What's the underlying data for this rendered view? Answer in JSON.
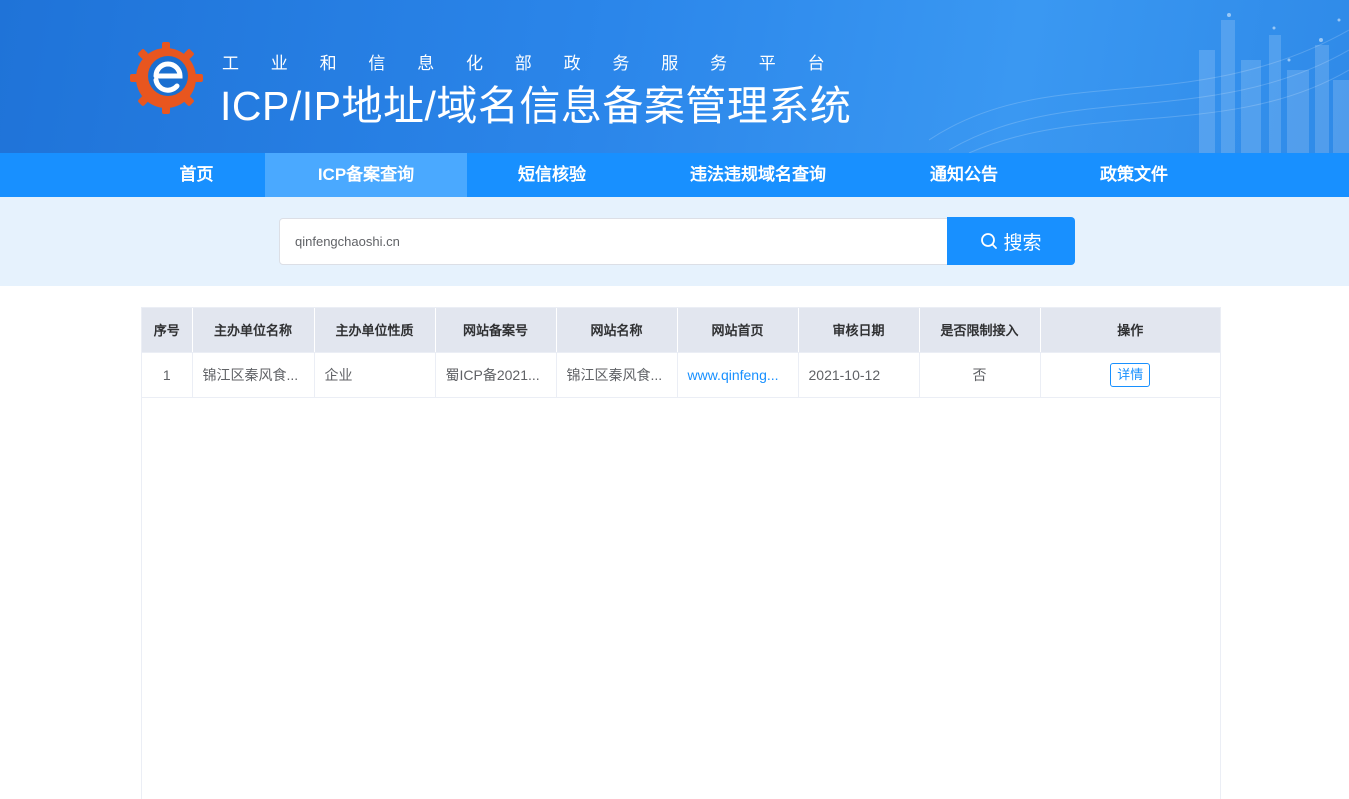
{
  "header": {
    "subtitle": "工业和信息化部政务服务平台",
    "title": "ICP/IP地址/域名信息备案管理系统"
  },
  "nav": {
    "items": [
      {
        "label": "首页"
      },
      {
        "label": "ICP备案查询",
        "active": true
      },
      {
        "label": "短信核验"
      },
      {
        "label": "违法违规域名查询"
      },
      {
        "label": "通知公告"
      },
      {
        "label": "政策文件"
      }
    ]
  },
  "search": {
    "value": "qinfengchaoshi.cn",
    "button_label": "搜索",
    "button_icon": "search-icon"
  },
  "table": {
    "columns": [
      "序号",
      "主办单位名称",
      "主办单位性质",
      "网站备案号",
      "网站名称",
      "网站首页",
      "审核日期",
      "是否限制接入",
      "操作"
    ],
    "rows": [
      {
        "index": "1",
        "org_name": "锦江区秦风食...",
        "org_type": "企业",
        "record_no": "蜀ICP备2021...",
        "site_name": "锦江区秦风食...",
        "homepage": "www.qinfeng...",
        "review_date": "2021-10-12",
        "restricted": "否",
        "action_label": "详情"
      }
    ]
  },
  "colors": {
    "banner_blue": "#2b86ea",
    "nav_blue": "#1890ff",
    "nav_active": "#4aa9ff",
    "search_bg": "#e6f2fd",
    "table_header_bg": "#e2e6ef",
    "logo_orange": "#e8561f"
  }
}
